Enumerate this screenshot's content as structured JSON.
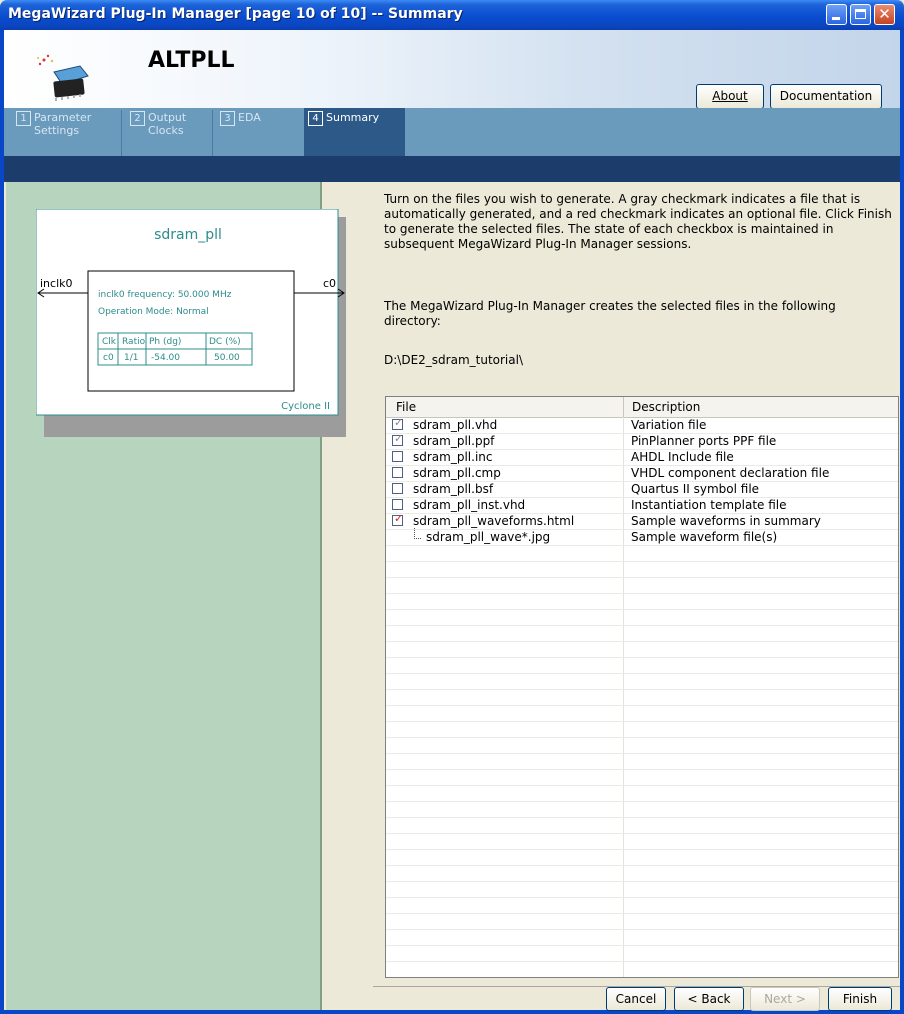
{
  "window": {
    "title": "MegaWizard Plug-In Manager [page 10 of 10] -- Summary"
  },
  "header": {
    "app_name": "ALTPLL",
    "about_label": "About",
    "documentation_label": "Documentation"
  },
  "tabs": [
    {
      "num": "1",
      "label": "Parameter\nSettings"
    },
    {
      "num": "2",
      "label": "Output\nClocks"
    },
    {
      "num": "3",
      "label": "EDA"
    },
    {
      "num": "4",
      "label": "Summary"
    }
  ],
  "diagram": {
    "title": "sdram_pll",
    "input_port": "inclk0",
    "output_port": "c0",
    "frequency": "inclk0 frequency: 50.000 MHz",
    "mode": "Operation Mode: Normal",
    "table_headers": [
      "Clk",
      "Ratio",
      "Ph (dg)",
      "DC (%)"
    ],
    "table_row": [
      "c0",
      "1/1",
      "-54.00",
      "50.00"
    ],
    "device": "Cyclone II"
  },
  "instructions": "Turn on the files you wish to generate. A gray checkmark indicates a file that is automatically generated, and a red checkmark indicates an optional file. Click Finish to generate the selected files. The state of each checkbox is maintained in subsequent MegaWizard Plug-In Manager sessions.",
  "dir_info": "The MegaWizard Plug-In Manager creates the selected files in the following directory:",
  "directory": "D:\\DE2_sdram_tutorial\\",
  "files_table": {
    "headers": {
      "file": "File",
      "description": "Description"
    },
    "rows": [
      {
        "file": "sdram_pll.vhd",
        "description": "Variation file",
        "check": "gray"
      },
      {
        "file": "sdram_pll.ppf",
        "description": "PinPlanner ports PPF file",
        "check": "gray"
      },
      {
        "file": "sdram_pll.inc",
        "description": "AHDL Include file",
        "check": "none"
      },
      {
        "file": "sdram_pll.cmp",
        "description": "VHDL component declaration file",
        "check": "none"
      },
      {
        "file": "sdram_pll.bsf",
        "description": "Quartus II symbol file",
        "check": "none"
      },
      {
        "file": "sdram_pll_inst.vhd",
        "description": "Instantiation template file",
        "check": "none"
      },
      {
        "file": "sdram_pll_waveforms.html",
        "description": "Sample waveforms in summary",
        "check": "red"
      },
      {
        "file": "sdram_pll_wave*.jpg",
        "description": "Sample waveform file(s)",
        "check": "child"
      }
    ]
  },
  "buttons": {
    "cancel": "Cancel",
    "back": "< Back",
    "next": "Next >",
    "finish": "Finish"
  },
  "colors": {
    "gray_check": "#8a8a8a",
    "red_check": "#d81e1e",
    "diagram_teal": "#2c8c8c"
  }
}
